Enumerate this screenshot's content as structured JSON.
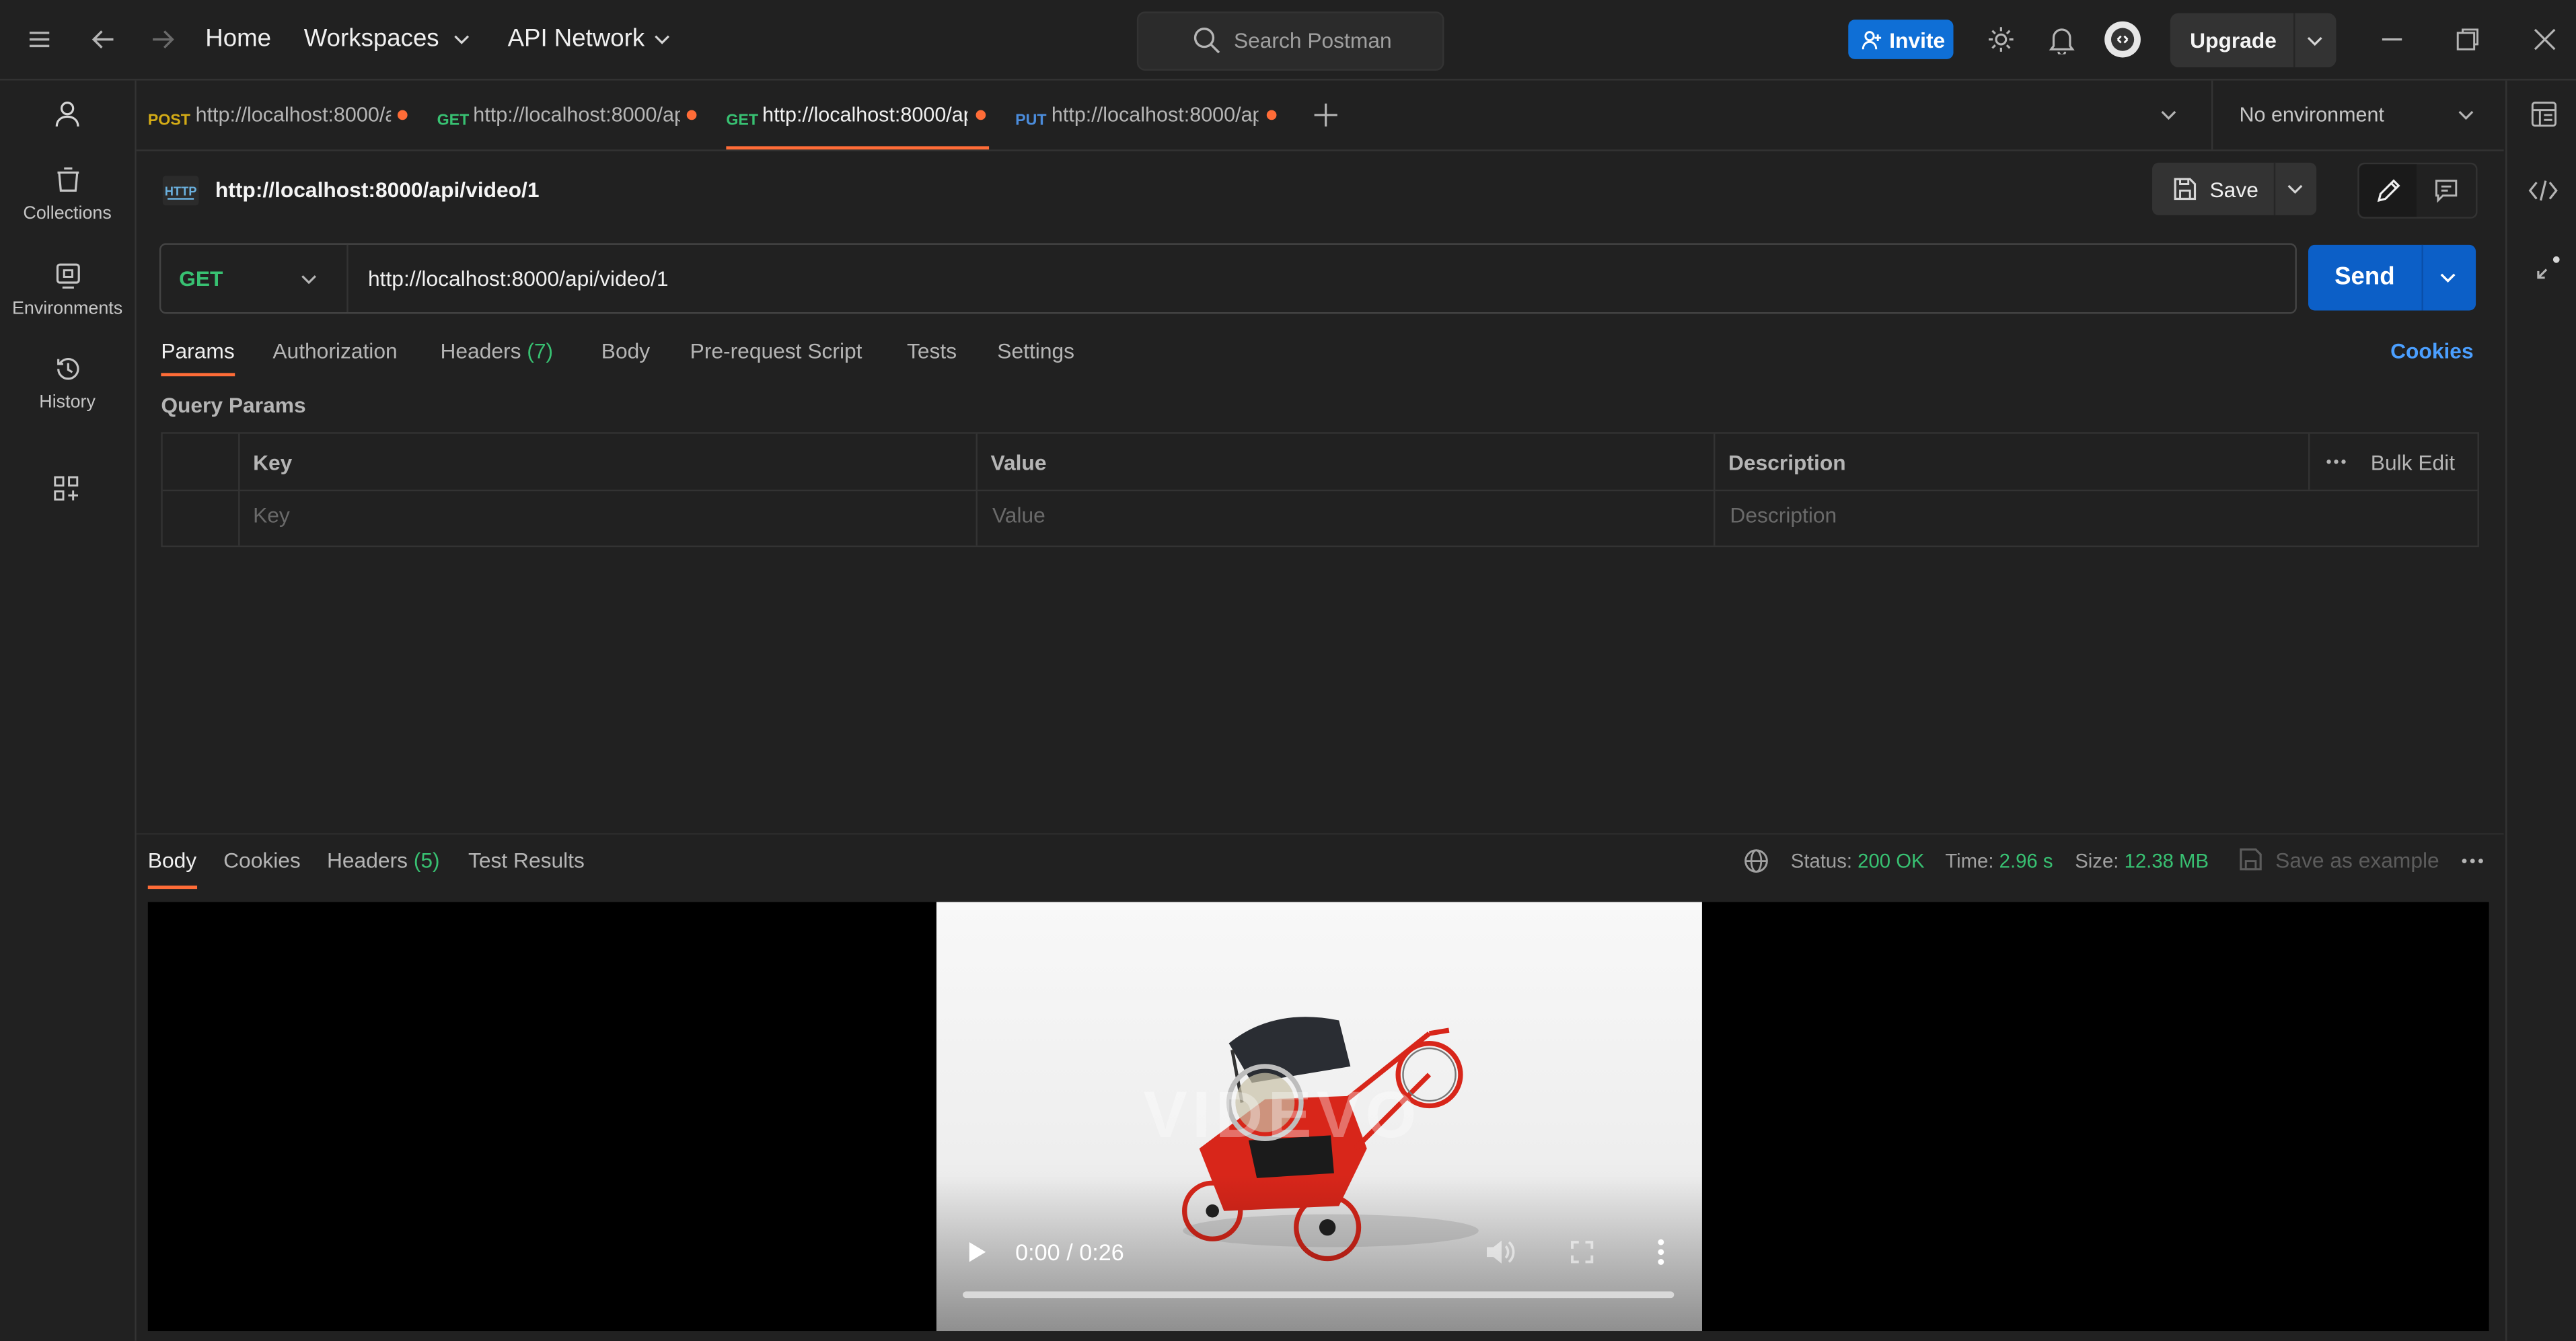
{
  "topbar": {
    "home": "Home",
    "workspaces": "Workspaces",
    "api_network": "API Network",
    "search_placeholder": "Search Postman",
    "invite": "Invite",
    "upgrade": "Upgrade"
  },
  "sidebar": {
    "items": [
      {
        "label": "Collections",
        "icon": "collections-icon"
      },
      {
        "label": "Environments",
        "icon": "environments-icon"
      },
      {
        "label": "History",
        "icon": "history-icon"
      }
    ]
  },
  "tabs": [
    {
      "method": "POST",
      "url": "http://localhost:8000/a",
      "method_color": "#d3ab16",
      "active": false
    },
    {
      "method": "GET",
      "url": "http://localhost:8000/ap",
      "method_color": "#38c172",
      "active": false
    },
    {
      "method": "GET",
      "url": "http://localhost:8000/ap",
      "method_color": "#38c172",
      "active": true
    },
    {
      "method": "PUT",
      "url": "http://localhost:8000/ap",
      "method_color": "#4b8cdb",
      "active": false
    }
  ],
  "environment": "No environment",
  "request": {
    "badge": "HTTP",
    "title": "http://localhost:8000/api/video/1",
    "save": "Save",
    "method": "GET",
    "url": "http://localhost:8000/api/video/1",
    "send": "Send"
  },
  "subtabs": {
    "params": "Params",
    "authorization": "Authorization",
    "headers": "Headers",
    "headers_count": "(7)",
    "body": "Body",
    "prerequest": "Pre-request Script",
    "tests": "Tests",
    "settings": "Settings",
    "cookies": "Cookies"
  },
  "query_params": {
    "title": "Query Params",
    "col_key": "Key",
    "col_value": "Value",
    "col_description": "Description",
    "bulk_edit": "Bulk Edit",
    "ph_key": "Key",
    "ph_value": "Value",
    "ph_description": "Description"
  },
  "response": {
    "tabs": {
      "body": "Body",
      "cookies": "Cookies",
      "headers": "Headers",
      "headers_count": "(5)",
      "tests": "Test Results"
    },
    "status_label": "Status:",
    "status_value": "200 OK",
    "time_label": "Time:",
    "time_value": "2.96 s",
    "size_label": "Size:",
    "size_value": "12.38 MB",
    "save_example": "Save as example"
  },
  "video": {
    "time": "0:00 / 0:26",
    "watermark": "VIDEVO",
    "progress": 0
  },
  "colors": {
    "accent": "#ff6c37",
    "send_blue": "#0c5fc7",
    "invite_blue": "#0f6fd6",
    "green": "#38c172"
  }
}
